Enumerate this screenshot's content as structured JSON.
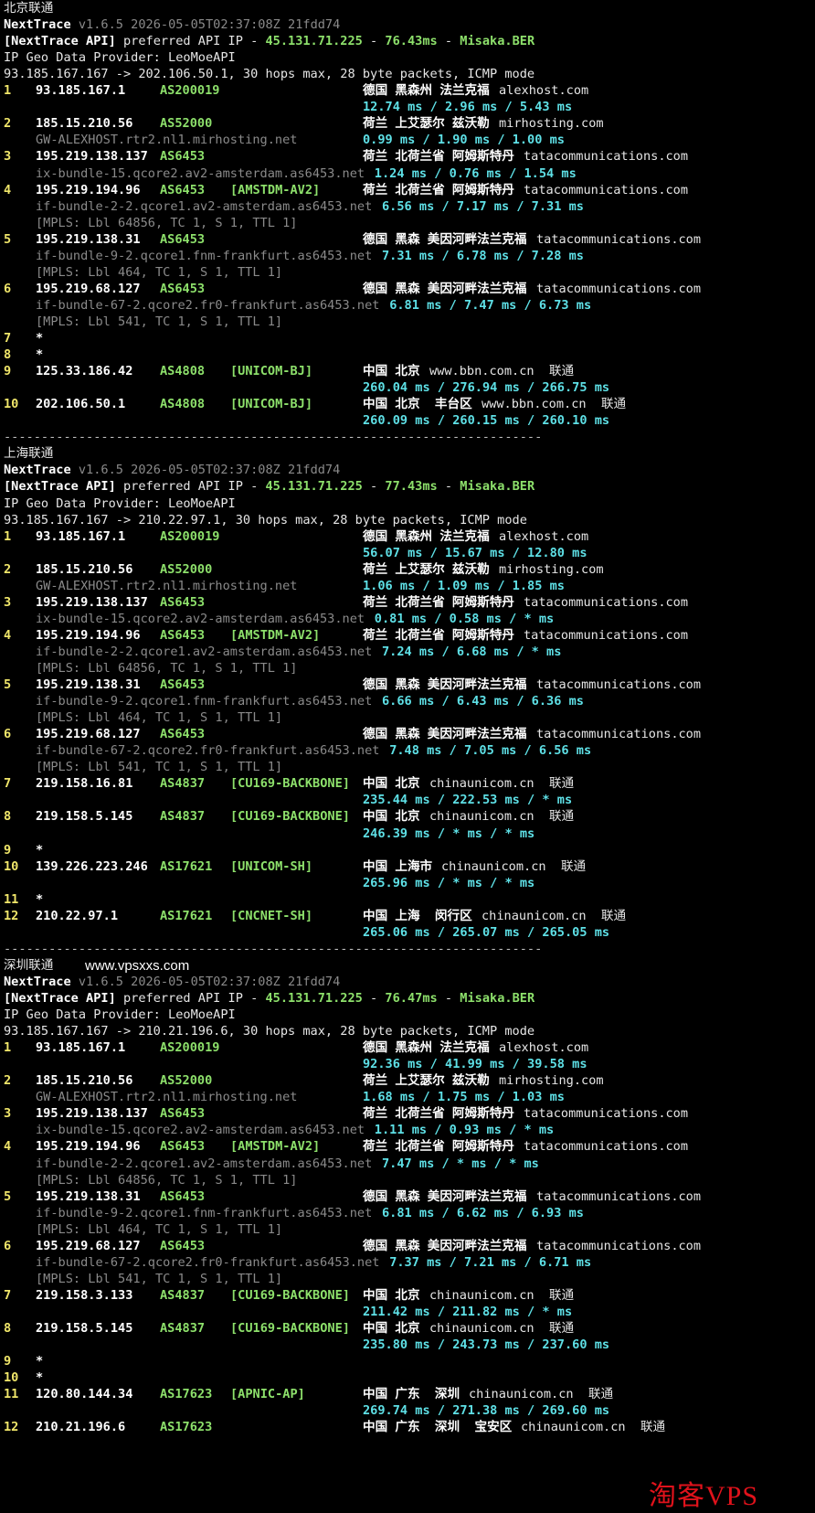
{
  "sections": [
    {
      "title": "北京联通",
      "tool": "NextTrace",
      "version": "v1.6.5 2026-05-05T02:37:08Z 21fdd74",
      "api_prefix": "[NextTrace API]",
      "api_text": "preferred API IP - ",
      "api_ip": "45.131.71.225",
      "dash1": " - ",
      "api_ms": "76.43ms",
      "dash2": " - ",
      "api_node": "Misaka.BER",
      "geo_provider": "IP Geo Data Provider: LeoMoeAPI",
      "target": "93.185.167.167 -> 202.106.50.1, 30 hops max, 28 byte packets, ICMP mode",
      "hops": [
        {
          "hop": "1",
          "ip": "93.185.167.1",
          "as": "AS200019",
          "tag": "",
          "geo": "德国 黑森州 法兰克福",
          "domain": "alexhost.com",
          "rtt": "12.74 ms / 2.96 ms / 5.43 ms",
          "host": "",
          "mpls": ""
        },
        {
          "hop": "2",
          "ip": "185.15.210.56",
          "as": "AS52000",
          "tag": "",
          "geo": "荷兰 上艾瑟尔 兹沃勒",
          "domain": "mirhosting.com",
          "host": "GW-ALEXHOST.rtr2.nl1.mirhosting.net",
          "rtt": "0.99 ms / 1.90 ms / 1.00 ms",
          "mpls": ""
        },
        {
          "hop": "3",
          "ip": "195.219.138.137",
          "as": "AS6453",
          "tag": "",
          "geo": "荷兰 北荷兰省 阿姆斯特丹",
          "domain": "tatacommunications.com",
          "host": "ix-bundle-15.qcore2.av2-amsterdam.as6453.net",
          "rtt": "1.24 ms / 0.76 ms / 1.54 ms",
          "mpls": ""
        },
        {
          "hop": "4",
          "ip": "195.219.194.96",
          "as": "AS6453",
          "tag": "[AMSTDM-AV2]",
          "geo": "荷兰 北荷兰省 阿姆斯特丹",
          "domain": "tatacommunications.com",
          "host": "if-bundle-2-2.qcore1.av2-amsterdam.as6453.net",
          "rtt": "6.56 ms / 7.17 ms / 7.31 ms",
          "mpls": "[MPLS: Lbl 64856, TC 1, S 1, TTL 1]"
        },
        {
          "hop": "5",
          "ip": "195.219.138.31",
          "as": "AS6453",
          "tag": "",
          "geo": "德国 黑森 美因河畔法兰克福",
          "domain": "tatacommunications.com",
          "host": "if-bundle-9-2.qcore1.fnm-frankfurt.as6453.net",
          "rtt": "7.31 ms / 6.78 ms / 7.28 ms",
          "mpls": "[MPLS: Lbl 464, TC 1, S 1, TTL 1]"
        },
        {
          "hop": "6",
          "ip": "195.219.68.127",
          "as": "AS6453",
          "tag": "",
          "geo": "德国 黑森 美因河畔法兰克福",
          "domain": "tatacommunications.com",
          "host": "if-bundle-67-2.qcore2.fr0-frankfurt.as6453.net",
          "rtt": "6.81 ms / 7.47 ms / 6.73 ms",
          "mpls": "[MPLS: Lbl 541, TC 1, S 1, TTL 1]"
        },
        {
          "hop": "7",
          "star": "*"
        },
        {
          "hop": "8",
          "star": "*"
        },
        {
          "hop": "9",
          "ip": "125.33.186.42",
          "as": "AS4808",
          "tag": "[UNICOM-BJ]",
          "geo": "中国 北京",
          "domain": "www.bbn.com.cn  联通",
          "rtt": "260.04 ms / 276.94 ms / 266.75 ms",
          "host": "",
          "mpls": ""
        },
        {
          "hop": "10",
          "ip": "202.106.50.1",
          "as": "AS4808",
          "tag": "[UNICOM-BJ]",
          "geo": "中国 北京  丰台区",
          "domain": "www.bbn.com.cn  联通",
          "rtt": "260.09 ms / 260.15 ms / 260.10 ms",
          "host": "",
          "mpls": ""
        }
      ]
    },
    {
      "title": "上海联通",
      "tool": "NextTrace",
      "version": "v1.6.5 2026-05-05T02:37:08Z 21fdd74",
      "api_prefix": "[NextTrace API]",
      "api_text": "preferred API IP - ",
      "api_ip": "45.131.71.225",
      "dash1": " - ",
      "api_ms": "77.43ms",
      "dash2": " - ",
      "api_node": "Misaka.BER",
      "geo_provider": "IP Geo Data Provider: LeoMoeAPI",
      "target": "93.185.167.167 -> 210.22.97.1, 30 hops max, 28 byte packets, ICMP mode",
      "hops": [
        {
          "hop": "1",
          "ip": "93.185.167.1",
          "as": "AS200019",
          "tag": "",
          "geo": "德国 黑森州 法兰克福",
          "domain": "alexhost.com",
          "rtt": "56.07 ms / 15.67 ms / 12.80 ms",
          "host": "",
          "mpls": ""
        },
        {
          "hop": "2",
          "ip": "185.15.210.56",
          "as": "AS52000",
          "tag": "",
          "geo": "荷兰 上艾瑟尔 兹沃勒",
          "domain": "mirhosting.com",
          "host": "GW-ALEXHOST.rtr2.nl1.mirhosting.net",
          "rtt": "1.06 ms / 1.09 ms / 1.85 ms",
          "mpls": ""
        },
        {
          "hop": "3",
          "ip": "195.219.138.137",
          "as": "AS6453",
          "tag": "",
          "geo": "荷兰 北荷兰省 阿姆斯特丹",
          "domain": "tatacommunications.com",
          "host": "ix-bundle-15.qcore2.av2-amsterdam.as6453.net",
          "rtt": "0.81 ms / 0.58 ms / * ms",
          "mpls": ""
        },
        {
          "hop": "4",
          "ip": "195.219.194.96",
          "as": "AS6453",
          "tag": "[AMSTDM-AV2]",
          "geo": "荷兰 北荷兰省 阿姆斯特丹",
          "domain": "tatacommunications.com",
          "host": "if-bundle-2-2.qcore1.av2-amsterdam.as6453.net",
          "rtt": "7.24 ms / 6.68 ms / * ms",
          "mpls": "[MPLS: Lbl 64856, TC 1, S 1, TTL 1]"
        },
        {
          "hop": "5",
          "ip": "195.219.138.31",
          "as": "AS6453",
          "tag": "",
          "geo": "德国 黑森 美因河畔法兰克福",
          "domain": "tatacommunications.com",
          "host": "if-bundle-9-2.qcore1.fnm-frankfurt.as6453.net",
          "rtt": "6.66 ms / 6.43 ms / 6.36 ms",
          "mpls": "[MPLS: Lbl 464, TC 1, S 1, TTL 1]"
        },
        {
          "hop": "6",
          "ip": "195.219.68.127",
          "as": "AS6453",
          "tag": "",
          "geo": "德国 黑森 美因河畔法兰克福",
          "domain": "tatacommunications.com",
          "host": "if-bundle-67-2.qcore2.fr0-frankfurt.as6453.net",
          "rtt": "7.48 ms / 7.05 ms / 6.56 ms",
          "mpls": "[MPLS: Lbl 541, TC 1, S 1, TTL 1]"
        },
        {
          "hop": "7",
          "ip": "219.158.16.81",
          "as": "AS4837",
          "tag": "[CU169-BACKBONE]",
          "geo": "中国 北京",
          "domain": "chinaunicom.cn  联通",
          "rtt": "235.44 ms / 222.53 ms / * ms",
          "host": "",
          "mpls": ""
        },
        {
          "hop": "8",
          "ip": "219.158.5.145",
          "as": "AS4837",
          "tag": "[CU169-BACKBONE]",
          "geo": "中国 北京",
          "domain": "chinaunicom.cn  联通",
          "rtt": "246.39 ms / * ms / * ms",
          "host": "",
          "mpls": ""
        },
        {
          "hop": "9",
          "star": "*"
        },
        {
          "hop": "10",
          "ip": "139.226.223.246",
          "as": "AS17621",
          "tag": "[UNICOM-SH]",
          "geo": "中国 上海市",
          "domain": "chinaunicom.cn  联通",
          "rtt": "265.96 ms / * ms / * ms",
          "host": "",
          "mpls": ""
        },
        {
          "hop": "11",
          "star": "*"
        },
        {
          "hop": "12",
          "ip": "210.22.97.1",
          "as": "AS17621",
          "tag": "[CNCNET-SH]",
          "geo": "中国 上海  闵行区",
          "domain": "chinaunicom.cn  联通",
          "rtt": "265.06 ms / 265.07 ms / 265.05 ms",
          "host": "",
          "mpls": ""
        }
      ]
    },
    {
      "title": "深圳联通",
      "tool": "NextTrace",
      "version": "v1.6.5 2026-05-05T02:37:08Z 21fdd74",
      "api_prefix": "[NextTrace API]",
      "api_text": "preferred API IP - ",
      "api_ip": "45.131.71.225",
      "dash1": " - ",
      "api_ms": "76.47ms",
      "dash2": " - ",
      "api_node": "Misaka.BER",
      "geo_provider": "IP Geo Data Provider: LeoMoeAPI",
      "target": "93.185.167.167 -> 210.21.196.6, 30 hops max, 28 byte packets, ICMP mode",
      "hops": [
        {
          "hop": "1",
          "ip": "93.185.167.1",
          "as": "AS200019",
          "tag": "",
          "geo": "德国 黑森州 法兰克福",
          "domain": "alexhost.com",
          "rtt": "92.36 ms / 41.99 ms / 39.58 ms",
          "host": "",
          "mpls": ""
        },
        {
          "hop": "2",
          "ip": "185.15.210.56",
          "as": "AS52000",
          "tag": "",
          "geo": "荷兰 上艾瑟尔 兹沃勒",
          "domain": "mirhosting.com",
          "host": "GW-ALEXHOST.rtr2.nl1.mirhosting.net",
          "rtt": "1.68 ms / 1.75 ms / 1.03 ms",
          "mpls": ""
        },
        {
          "hop": "3",
          "ip": "195.219.138.137",
          "as": "AS6453",
          "tag": "",
          "geo": "荷兰 北荷兰省 阿姆斯特丹",
          "domain": "tatacommunications.com",
          "host": "ix-bundle-15.qcore2.av2-amsterdam.as6453.net",
          "rtt": "1.11 ms / 0.93 ms / * ms",
          "mpls": ""
        },
        {
          "hop": "4",
          "ip": "195.219.194.96",
          "as": "AS6453",
          "tag": "[AMSTDM-AV2]",
          "geo": "荷兰 北荷兰省 阿姆斯特丹",
          "domain": "tatacommunications.com",
          "host": "if-bundle-2-2.qcore1.av2-amsterdam.as6453.net",
          "rtt": "7.47 ms / * ms / * ms",
          "mpls": "[MPLS: Lbl 64856, TC 1, S 1, TTL 1]"
        },
        {
          "hop": "5",
          "ip": "195.219.138.31",
          "as": "AS6453",
          "tag": "",
          "geo": "德国 黑森 美因河畔法兰克福",
          "domain": "tatacommunications.com",
          "host": "if-bundle-9-2.qcore1.fnm-frankfurt.as6453.net",
          "rtt": "6.81 ms / 6.62 ms / 6.93 ms",
          "mpls": "[MPLS: Lbl 464, TC 1, S 1, TTL 1]"
        },
        {
          "hop": "6",
          "ip": "195.219.68.127",
          "as": "AS6453",
          "tag": "",
          "geo": "德国 黑森 美因河畔法兰克福",
          "domain": "tatacommunications.com",
          "host": "if-bundle-67-2.qcore2.fr0-frankfurt.as6453.net",
          "rtt": "7.37 ms / 7.21 ms / 6.71 ms",
          "mpls": "[MPLS: Lbl 541, TC 1, S 1, TTL 1]"
        },
        {
          "hop": "7",
          "ip": "219.158.3.133",
          "as": "AS4837",
          "tag": "[CU169-BACKBONE]",
          "geo": "中国 北京",
          "domain": "chinaunicom.cn  联通",
          "rtt": "211.42 ms / 211.82 ms / * ms",
          "host": "",
          "mpls": ""
        },
        {
          "hop": "8",
          "ip": "219.158.5.145",
          "as": "AS4837",
          "tag": "[CU169-BACKBONE]",
          "geo": "中国 北京",
          "domain": "chinaunicom.cn  联通",
          "rtt": "235.80 ms / 243.73 ms / 237.60 ms",
          "host": "",
          "mpls": ""
        },
        {
          "hop": "9",
          "star": "*"
        },
        {
          "hop": "10",
          "star": "*"
        },
        {
          "hop": "11",
          "ip": "120.80.144.34",
          "as": "AS17623",
          "tag": "[APNIC-AP]",
          "geo": "中国 广东  深圳",
          "domain": "chinaunicom.cn  联通",
          "rtt": "269.74 ms / 271.38 ms / 269.60 ms",
          "host": "",
          "mpls": ""
        },
        {
          "hop": "12",
          "ip": "210.21.196.6",
          "as": "AS17623",
          "tag": "",
          "geo": "中国 广东  深圳  宝安区",
          "domain": "chinaunicom.cn  联通",
          "rtt": "",
          "host": "",
          "mpls": ""
        }
      ]
    }
  ],
  "separator": "------------------------------------------------------------------------",
  "watermark_site": "www.vpsxxs.com",
  "watermark_brand": "淘客VPS"
}
